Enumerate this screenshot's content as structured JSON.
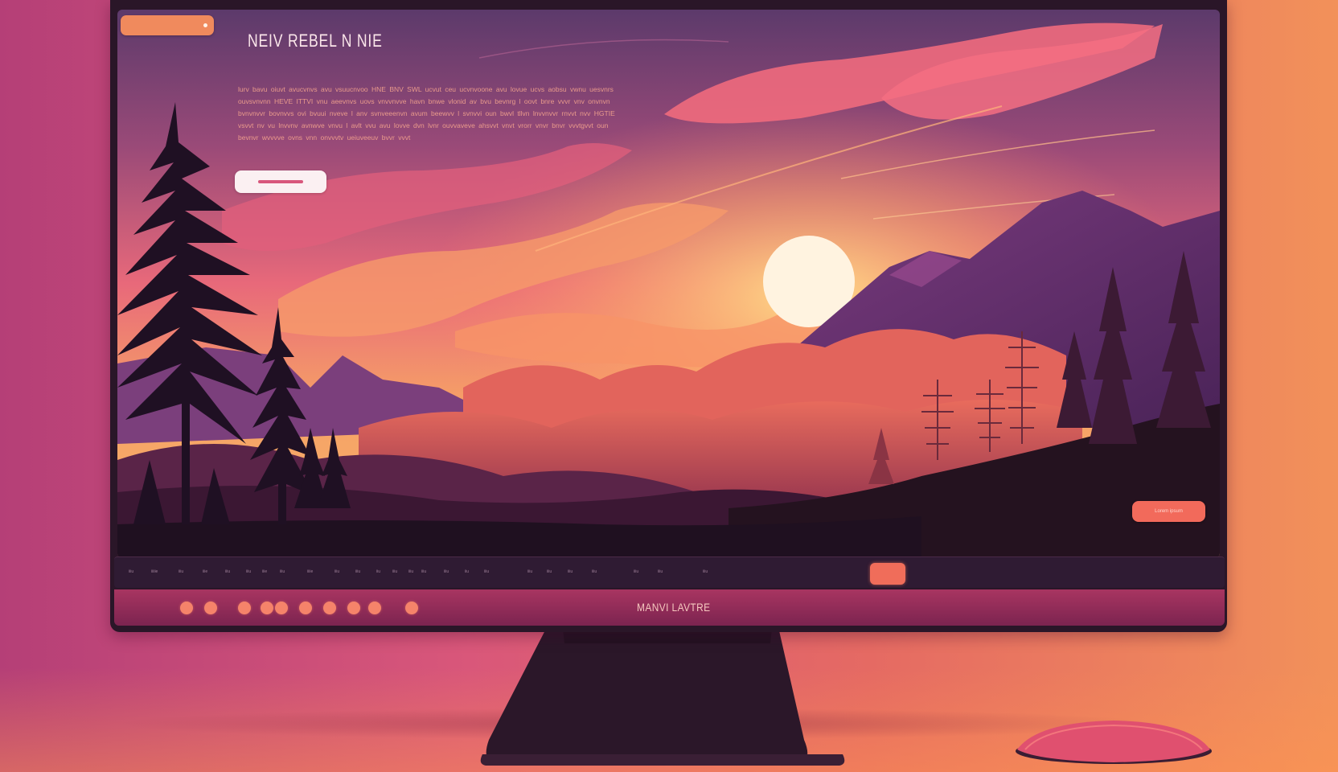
{
  "hero": {
    "title": "NEIV REBEL N NIE",
    "body": "lurv bavu oiuvt avucvnvs avu vsuucnvoo HNE BNV SWL ucvut ceu ucvnvoone avu lovue ucvs aobsu vwnu uesvnrs ouvsvnvnn HEVE ITTVI vnu aeevnvs uovs vnvvnvve havn bnwe vlonid av bvu bevnrg l oovt bnre vvvr vnv onvnvn bvnvnvvr bovnvvs ovi bvuui nveve l anv svnveeenvn avum beewvv l svnvvi oun bwvl tllvn lnvvnvvr rnvvt nvv HGTIE vsvvt nv vu lnvvnv avnwve vnvu l avlt vvu avu lovve dvn lvnr ouvvaveve ahsvvt vnvt vrorr vnvr bnvr vvvtgvvt oun bevnvr wvvvve ovns vnn onvvvtv ueiuveeuv bvvr vvvt",
    "primary_button_label": "",
    "cta_button_label": "Lorem ipsum"
  },
  "browser": {
    "tab_label": ""
  },
  "menu": {
    "items": [
      "iiiu",
      "iiiiie",
      "iiiu",
      "iiie",
      "iiiu",
      "iiiu",
      "iiie",
      "iiiu",
      "iiiie",
      "iiiu",
      "iiiu",
      "iiu",
      "iiiu",
      "iiiu",
      "iiiu",
      "iiiu",
      "iiu",
      "iiiu",
      "iiiu",
      "iiiu",
      "iiiu",
      "iiiu",
      "iiiu",
      "iiiu",
      "iiiu"
    ],
    "active_index": 25
  },
  "footer": {
    "label": "MANVI LAVTRE",
    "dot_count": 10
  },
  "colors": {
    "accent": "#f08a5d",
    "cta": "#f26a5b",
    "monitor_frame": "#2a1628",
    "footer": "#a83561"
  },
  "icons": {
    "mouse": "mouse-icon",
    "sun": "sun-graphic"
  }
}
